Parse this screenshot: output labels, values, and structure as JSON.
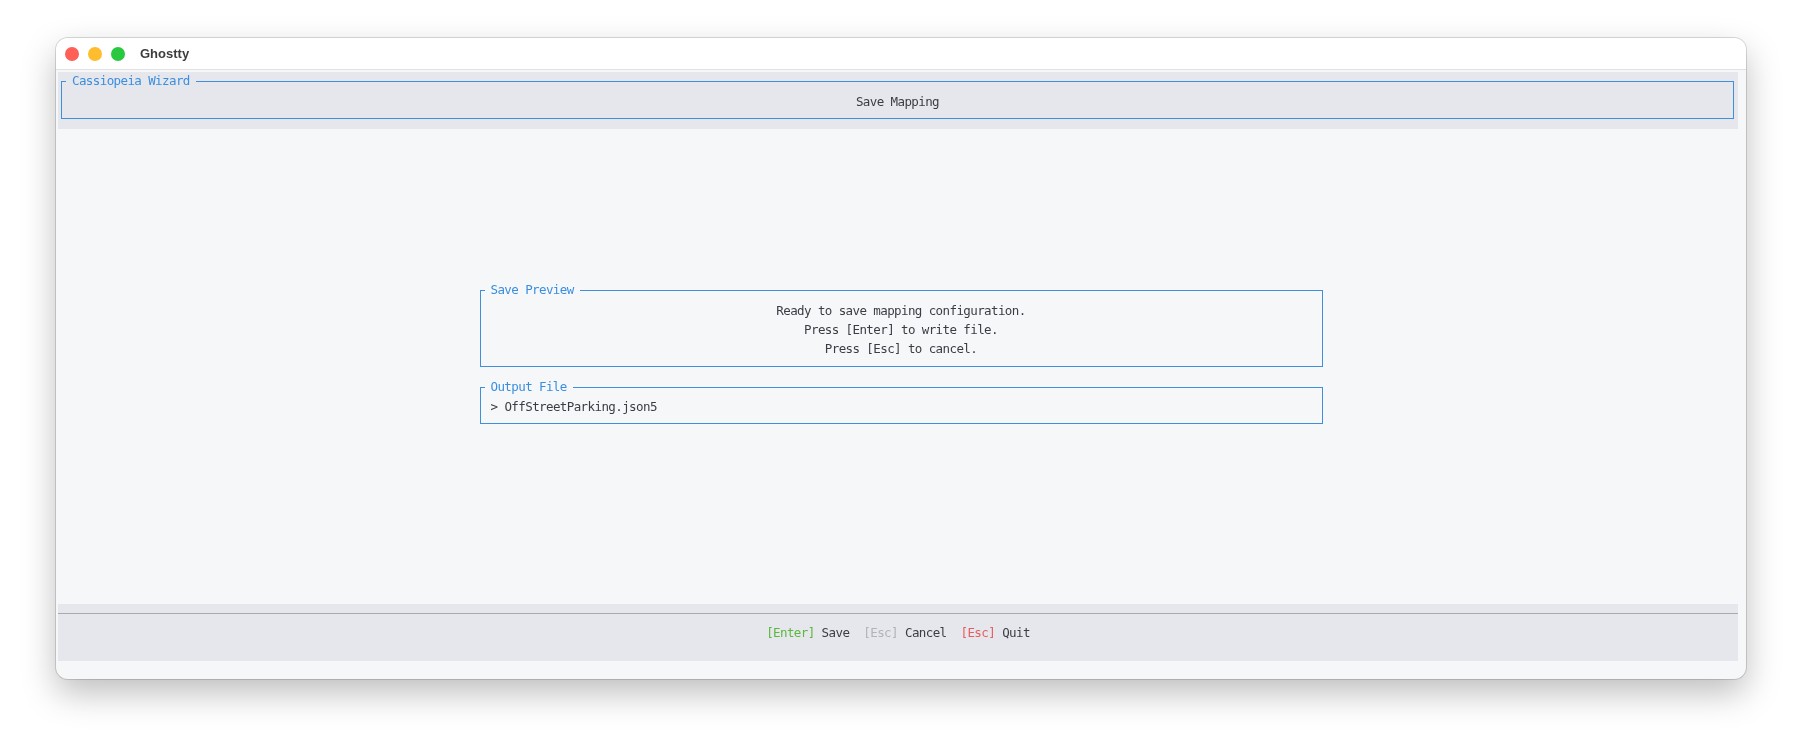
{
  "window": {
    "title": "Ghostty"
  },
  "header": {
    "title": "Cassiopeia Wizard",
    "screen": "Save Mapping"
  },
  "panels": [
    {
      "kind": "message",
      "title": "Save Preview",
      "lines": [
        "Ready to save mapping configuration.",
        "Press [Enter] to write file.",
        "Press [Esc] to cancel."
      ]
    },
    {
      "kind": "input",
      "title": "Output File",
      "prompt": ">",
      "value": "OffStreetParking.json5"
    }
  ],
  "footer": {
    "hints": [
      {
        "key": "[Enter]",
        "label": "Save",
        "color": "#5cb83c"
      },
      {
        "key": "[Esc]",
        "label": "Cancel",
        "color": "#b2b3ba"
      },
      {
        "key": "[Esc]",
        "label": "Quit",
        "color": "#e85d5d"
      }
    ]
  }
}
